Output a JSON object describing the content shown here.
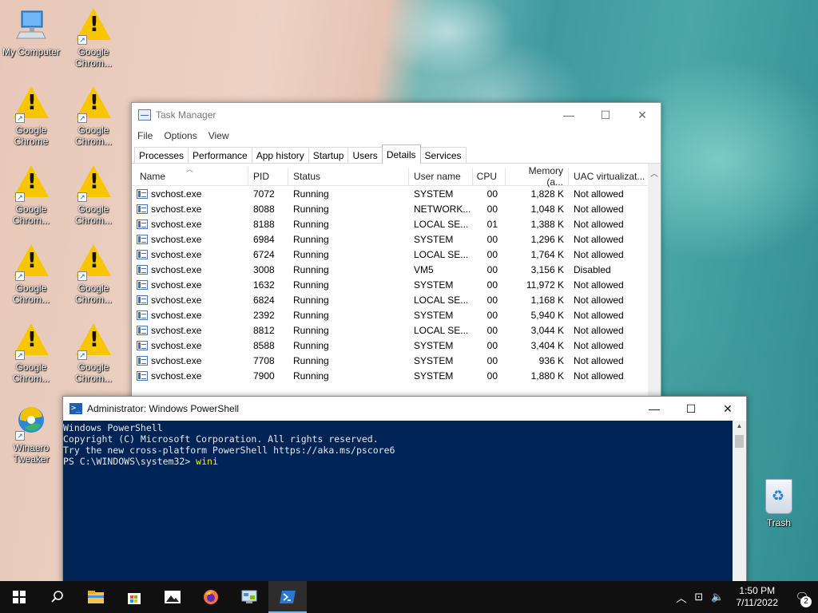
{
  "desktop": {
    "icons": [
      {
        "label": "My Computer",
        "icon": "computer-icon"
      },
      {
        "label": "Google Chrom...",
        "icon": "warning-icon"
      },
      {
        "label": "Google Chrome",
        "icon": "warning-icon"
      },
      {
        "label": "Google Chrom...",
        "icon": "warning-icon"
      },
      {
        "label": "Google Chrom...",
        "icon": "warning-icon"
      },
      {
        "label": "Google Chrom...",
        "icon": "warning-icon"
      },
      {
        "label": "Google Chrom...",
        "icon": "warning-icon"
      },
      {
        "label": "Google Chrom...",
        "icon": "warning-icon"
      },
      {
        "label": "Google Chrom...",
        "icon": "warning-icon"
      },
      {
        "label": "Google Chrom...",
        "icon": "warning-icon"
      },
      {
        "label": "Winaero Tweaker",
        "icon": "winaero-icon"
      }
    ],
    "trash_label": "Trash"
  },
  "taskmgr": {
    "title": "Task Manager",
    "menu": [
      "File",
      "Options",
      "View"
    ],
    "tabs": [
      "Processes",
      "Performance",
      "App history",
      "Startup",
      "Users",
      "Details",
      "Services"
    ],
    "active_tab": "Details",
    "columns": [
      "Name",
      "PID",
      "Status",
      "User name",
      "CPU",
      "Memory (a...",
      "UAC virtualizat..."
    ],
    "rows": [
      [
        "svchost.exe",
        "7072",
        "Running",
        "SYSTEM",
        "00",
        "1,828 K",
        "Not allowed"
      ],
      [
        "svchost.exe",
        "8088",
        "Running",
        "NETWORK...",
        "00",
        "1,048 K",
        "Not allowed"
      ],
      [
        "svchost.exe",
        "8188",
        "Running",
        "LOCAL SE...",
        "01",
        "1,388 K",
        "Not allowed"
      ],
      [
        "svchost.exe",
        "6984",
        "Running",
        "SYSTEM",
        "00",
        "1,296 K",
        "Not allowed"
      ],
      [
        "svchost.exe",
        "6724",
        "Running",
        "LOCAL SE...",
        "00",
        "1,764 K",
        "Not allowed"
      ],
      [
        "svchost.exe",
        "3008",
        "Running",
        "VM5",
        "00",
        "3,156 K",
        "Disabled"
      ],
      [
        "svchost.exe",
        "1632",
        "Running",
        "SYSTEM",
        "00",
        "11,972 K",
        "Not allowed"
      ],
      [
        "svchost.exe",
        "6824",
        "Running",
        "LOCAL SE...",
        "00",
        "1,168 K",
        "Not allowed"
      ],
      [
        "svchost.exe",
        "2392",
        "Running",
        "SYSTEM",
        "00",
        "5,940 K",
        "Not allowed"
      ],
      [
        "svchost.exe",
        "8812",
        "Running",
        "LOCAL SE...",
        "00",
        "3,044 K",
        "Not allowed"
      ],
      [
        "svchost.exe",
        "8588",
        "Running",
        "SYSTEM",
        "00",
        "3,404 K",
        "Not allowed"
      ],
      [
        "svchost.exe",
        "7708",
        "Running",
        "SYSTEM",
        "00",
        "936 K",
        "Not allowed"
      ],
      [
        "svchost.exe",
        "7900",
        "Running",
        "SYSTEM",
        "00",
        "1,880 K",
        "Not allowed"
      ]
    ]
  },
  "powershell": {
    "title": "Administrator: Windows PowerShell",
    "lines": [
      "Windows PowerShell",
      "Copyright (C) Microsoft Corporation. All rights reserved.",
      "",
      "Try the new cross-platform PowerShell https://aka.ms/pscore6",
      ""
    ],
    "prompt": "PS C:\\WINDOWS\\system32> ",
    "command": "wini"
  },
  "taskbar": {
    "apps": [
      "file-explorer-icon",
      "store-icon",
      "photos-icon",
      "firefox-icon",
      "control-panel-icon",
      "powershell-icon"
    ],
    "active_app": "powershell-icon",
    "time": "1:50 PM",
    "date": "7/11/2022",
    "notification_count": "2"
  },
  "colors": {
    "powershell_bg": "#012456",
    "powershell_cmd": "#f2f200",
    "taskbar_bg": "#101010",
    "warning_yellow": "#f7c600"
  }
}
